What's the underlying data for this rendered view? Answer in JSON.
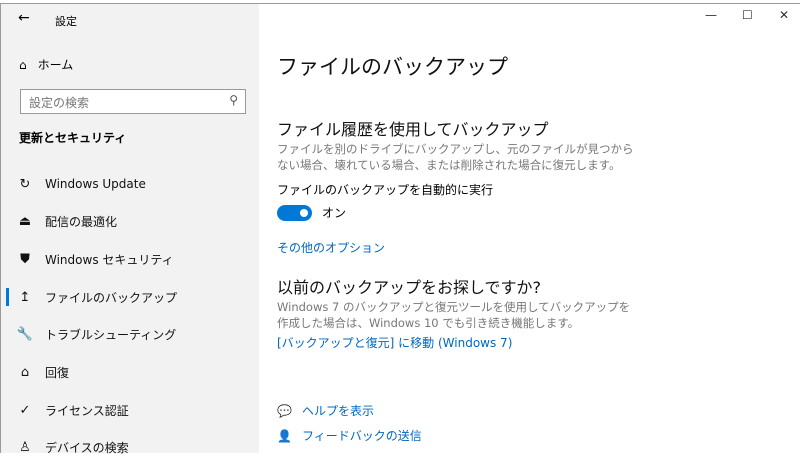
{
  "window": {
    "title": "設定",
    "minimize_icon": "—",
    "maximize_icon": "☐",
    "close_icon": "✕"
  },
  "sidebar": {
    "home": "ホーム",
    "search_placeholder": "設定の検索",
    "section": "更新とセキュリティ",
    "items": [
      {
        "label": "Windows Update",
        "icon": "↻"
      },
      {
        "label": "配信の最適化",
        "icon": "⏏"
      },
      {
        "label": "Windows セキュリティ",
        "icon": "⛊"
      },
      {
        "label": "ファイルのバックアップ",
        "icon": "↥"
      },
      {
        "label": "トラブルシューティング",
        "icon": "🔧"
      },
      {
        "label": "回復",
        "icon": "⌂"
      },
      {
        "label": "ライセンス認証",
        "icon": "✓"
      },
      {
        "label": "デバイスの検索",
        "icon": "♙"
      }
    ]
  },
  "main": {
    "title": "ファイルのバックアップ",
    "history_heading": "ファイル履歴を使用してバックアップ",
    "history_desc": "ファイルを別のドライブにバックアップし、元のファイルが見つからない場合、壊れている場合、または削除された場合に復元します。",
    "auto_label": "ファイルのバックアップを自動的に実行",
    "toggle_state": "オン",
    "toggle_on": true,
    "more_options": "その他のオプション",
    "older_heading": "以前のバックアップをお探しですか?",
    "older_desc": "Windows 7 のバックアップと復元ツールを使用してバックアップを作成した場合は、Windows 10 でも引き続き機能します。",
    "older_link": "[バックアップと復元] に移動 (Windows 7)",
    "help": "ヘルプを表示",
    "feedback": "フィードバックの送信"
  }
}
